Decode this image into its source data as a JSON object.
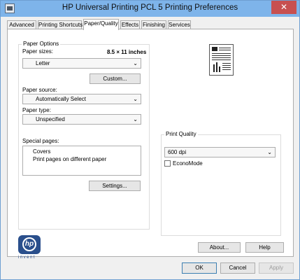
{
  "window": {
    "title": "HP Universal Printing PCL 5 Printing Preferences",
    "close_glyph": "✕"
  },
  "tabs": [
    {
      "label": "Advanced"
    },
    {
      "label": "Printing Shortcuts"
    },
    {
      "label": "Paper/Quality"
    },
    {
      "label": "Effects"
    },
    {
      "label": "Finishing"
    },
    {
      "label": "Services"
    }
  ],
  "active_tab": "Paper/Quality",
  "paper_options": {
    "title": "Paper Options",
    "paper_sizes_label": "Paper sizes:",
    "paper_size_value": "8.5 × 11 inches",
    "paper_size_selected": "Letter",
    "custom_button": "Custom...",
    "paper_source_label": "Paper source:",
    "paper_source_selected": "Automatically Select",
    "paper_type_label": "Paper type:",
    "paper_type_selected": "Unspecified",
    "special_pages_label": "Special pages:",
    "special_pages_items": [
      "Covers",
      "Print pages on different paper"
    ],
    "settings_button": "Settings..."
  },
  "print_quality": {
    "title": "Print Quality",
    "selected": "600 dpi",
    "economode_label": "EconoMode",
    "economode_checked": false
  },
  "logo": {
    "mark": "hp",
    "tagline": "invent"
  },
  "panel_buttons": {
    "about": "About...",
    "help": "Help"
  },
  "dialog_buttons": {
    "ok": "OK",
    "cancel": "Cancel",
    "apply": "Apply"
  },
  "dropdown_arrow": "⌄"
}
